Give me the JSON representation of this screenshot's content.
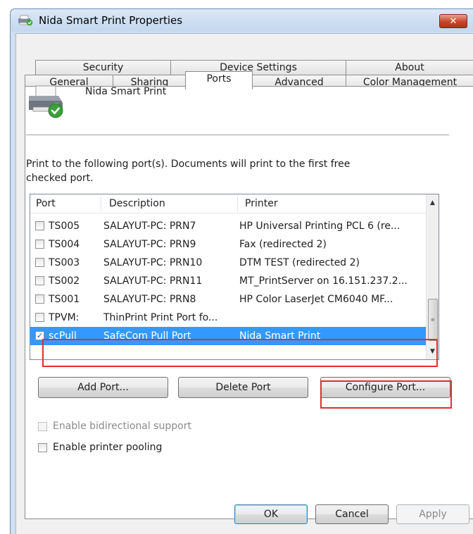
{
  "window": {
    "title": "Nida Smart Print Properties",
    "close_glyph": "✕"
  },
  "tabs_row1": [
    {
      "label": "Security"
    },
    {
      "label": "Device Settings"
    },
    {
      "label": "About"
    }
  ],
  "tabs_row2": [
    {
      "label": "General"
    },
    {
      "label": "Sharing"
    },
    {
      "label": "Ports",
      "active": true
    },
    {
      "label": "Advanced"
    },
    {
      "label": "Color Management"
    }
  ],
  "printer": {
    "name": "Nida Smart Print",
    "icon": "printer-check-icon"
  },
  "intro_text": "Print to the following port(s). Documents will print to the first free checked port.",
  "port_list": {
    "columns": [
      "Port",
      "Description",
      "Printer"
    ],
    "rows": [
      {
        "port": "TS005",
        "description": "SALAYUT-PC: PRN7",
        "printer": "HP Universal Printing PCL 6 (re...",
        "checked": false,
        "selected": false
      },
      {
        "port": "TS004",
        "description": "SALAYUT-PC: PRN9",
        "printer": "Fax (redirected 2)",
        "checked": false,
        "selected": false
      },
      {
        "port": "TS003",
        "description": "SALAYUT-PC: PRN10",
        "printer": "DTM TEST (redirected 2)",
        "checked": false,
        "selected": false
      },
      {
        "port": "TS002",
        "description": "SALAYUT-PC: PRN11",
        "printer": "MT_PrintServer on 16.151.237.2...",
        "checked": false,
        "selected": false
      },
      {
        "port": "TS001",
        "description": "SALAYUT-PC: PRN8",
        "printer": "HP Color LaserJet CM6040 MF...",
        "checked": false,
        "selected": false
      },
      {
        "port": "TPVM:",
        "description": "ThinPrint Print Port fo...",
        "printer": "",
        "checked": false,
        "selected": false
      },
      {
        "port": "scPull",
        "description": "SafeCom Pull Port",
        "printer": "Nida Smart Print",
        "checked": true,
        "selected": true
      }
    ]
  },
  "buttons": {
    "add_port": "Add Port...",
    "delete_port": "Delete Port",
    "configure_port": "Configure Port...",
    "ok": "OK",
    "cancel": "Cancel",
    "apply": "Apply"
  },
  "options": {
    "bidirectional": {
      "label": "Enable bidirectional support",
      "checked": false,
      "enabled": false
    },
    "pooling": {
      "label": "Enable printer pooling",
      "checked": false,
      "enabled": true
    }
  },
  "colors": {
    "selection": "#3399ff",
    "highlight_box": "#e03030"
  }
}
